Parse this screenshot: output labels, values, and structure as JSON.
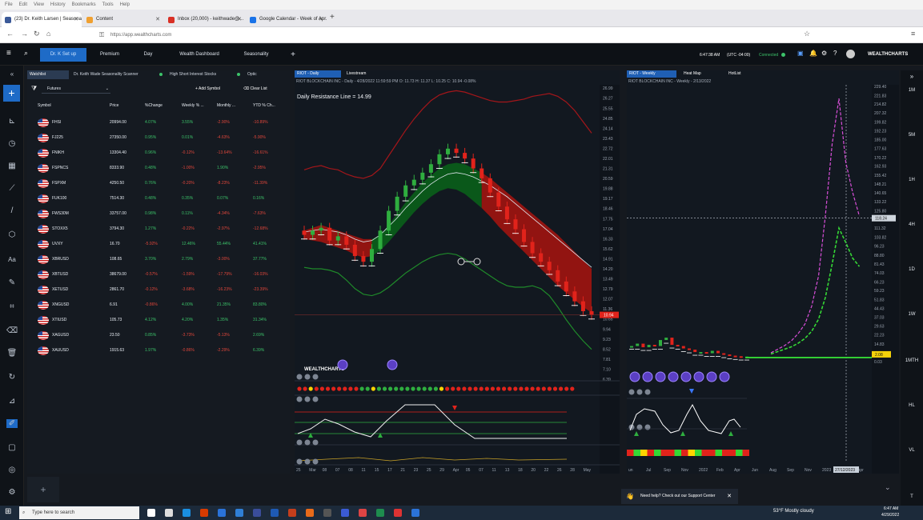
{
  "browser": {
    "menu": [
      "File",
      "Edit",
      "View",
      "History",
      "Bookmarks",
      "Tools",
      "Help"
    ],
    "tabs": [
      {
        "label": "(23) Dr. Keith Larsen | Seasonal",
        "favicon_color": "#3b5998",
        "active": true
      },
      {
        "label": "Content",
        "favicon_color": "#f0a030",
        "active": false
      },
      {
        "label": "Inbox (20,000) - keithwade@...",
        "favicon_color": "#d93025",
        "active": false
      },
      {
        "label": "Google Calendar - Week of Apr...",
        "favicon_color": "#1a73e8",
        "active": false
      }
    ],
    "url": "https://app.wealthcharts.com"
  },
  "nav": {
    "tabs": [
      "Dr. K Set up",
      "Premium",
      "Day",
      "Wealth Dashboard",
      "Seasonality"
    ],
    "add": "+",
    "time": "6:47:38 AM",
    "timezone": "(UTC -04:00)",
    "status": "Connected",
    "brand": "WEALTHCHARTS"
  },
  "watchlist": {
    "tabs": [
      "Watchlist",
      "Dr. Keith Wade Seasonality Scanner",
      "High Short Interest Stocks",
      "Optic"
    ],
    "filter": "Futures",
    "add_symbol": "Add Symbol",
    "clear_list": "Clear List",
    "columns": [
      "Symbol",
      "Price",
      "%Change",
      "Weekly % ...",
      "Monthly ...",
      "YTD % Ch..."
    ],
    "rows": [
      {
        "symbol": "FHSI",
        "price": "20994.00",
        "change": "4.07%",
        "weekly": "3.55%",
        "monthly": "-2.90%",
        "ytd": "-10.89%"
      },
      {
        "symbol": "FJ225",
        "price": "27350.00",
        "change": "0.95%",
        "weekly": "0.01%",
        "monthly": "-4.63%",
        "ytd": "-5.90%"
      },
      {
        "symbol": "FNIKH",
        "price": "13304.40",
        "change": "0.96%",
        "weekly": "-0.12%",
        "monthly": "-13.64%",
        "ytd": "-16.61%"
      },
      {
        "symbol": "FSPNCS",
        "price": "8333.90",
        "change": "0.48%",
        "weekly": "-1.00%",
        "monthly": "1.90%",
        "ytd": "-2.95%"
      },
      {
        "symbol": "FSPXM",
        "price": "4250.50",
        "change": "0.76%",
        "weekly": "-0.20%",
        "monthly": "-8.23%",
        "ytd": "-11.39%"
      },
      {
        "symbol": "FUK100",
        "price": "7514.30",
        "change": "0.48%",
        "weekly": "0.35%",
        "monthly": "0.07%",
        "ytd": "0.16%"
      },
      {
        "symbol": "FWS30M",
        "price": "33757.00",
        "change": "0.98%",
        "weekly": "0.11%",
        "monthly": "-4.34%",
        "ytd": "-7.63%"
      },
      {
        "symbol": "STOXX5",
        "price": "3794.30",
        "change": "1.27%",
        "weekly": "-0.22%",
        "monthly": "-2.97%",
        "ytd": "-12.68%"
      },
      {
        "symbol": "UVXY",
        "price": "16.70",
        "change": "-5.92%",
        "weekly": "12.46%",
        "monthly": "55.44%",
        "ytd": "41.41%"
      },
      {
        "symbol": "XBRUSD",
        "price": "108.65",
        "change": "3.70%",
        "weekly": "2.79%",
        "monthly": "-3.00%",
        "ytd": "37.77%"
      },
      {
        "symbol": "XBTUSD",
        "price": "38679.00",
        "change": "-0.57%",
        "weekly": "-1.59%",
        "monthly": "-17.79%",
        "ytd": "-16.03%"
      },
      {
        "symbol": "XETUSD",
        "price": "2861.70",
        "change": "-0.12%",
        "weekly": "-3.68%",
        "monthly": "-16.23%",
        "ytd": "-23.39%"
      },
      {
        "symbol": "XNGUSD",
        "price": "6.91",
        "change": "-0.86%",
        "weekly": "4.00%",
        "monthly": "21.35%",
        "ytd": "83.80%"
      },
      {
        "symbol": "XTIUSD",
        "price": "105.73",
        "change": "4.12%",
        "weekly": "4.20%",
        "monthly": "1.35%",
        "ytd": "31.34%"
      },
      {
        "symbol": "XAGUSD",
        "price": "23.50",
        "change": "0.85%",
        "weekly": "-3.73%",
        "monthly": "-5.13%",
        "ytd": "2.69%"
      },
      {
        "symbol": "XAUUSD",
        "price": "1915.63",
        "change": "1.97%",
        "weekly": "-0.86%",
        "monthly": "-2.29%",
        "ytd": "6.39%"
      }
    ]
  },
  "daily_chart": {
    "tabs": [
      "RIOT - Daily",
      "Livestream"
    ],
    "info": "RIOT BLOCKCHAIN INC - Daily - 4/28/2022 11:59:59 PM O: 11.73 H: 11.37 L: 10.25 C: 10.94 -0.08%",
    "resistance": "Daily Resistance Line = 14.99",
    "price_label": "10.94",
    "watermark": "WEALTHCHARTS",
    "price_axis": [
      "26.99",
      "26.27",
      "25.55",
      "24.85",
      "24.14",
      "23.43",
      "22.72",
      "22.01",
      "21.31",
      "20.59",
      "19.88",
      "19.17",
      "18.46",
      "17.75",
      "17.04",
      "16.33",
      "15.62",
      "14.91",
      "14.20",
      "13.49",
      "12.79",
      "12.07",
      "11.36",
      "10.65",
      "9.94",
      "9.23",
      "8.52",
      "7.81",
      "7.10",
      "6.39"
    ],
    "dates": [
      "25",
      "Mar",
      "08",
      "07",
      "08",
      "11",
      "15",
      "17",
      "21",
      "23",
      "25",
      "29",
      "Apr",
      "05",
      "07",
      "11",
      "13",
      "18",
      "20",
      "22",
      "26",
      "28",
      "May"
    ]
  },
  "weekly_chart": {
    "tabs": [
      "RIOT - Weekly",
      "Heat Map",
      "HotList"
    ],
    "info": "RIOT BLOCKCHAIN INC - Weekly - 2/13/2022",
    "price_label": "118.24",
    "low_label": "2.08",
    "price_axis": [
      "229.40",
      "221.83",
      "214.82",
      "207.32",
      "199.82",
      "192.23",
      "185.00",
      "177.63",
      "170.22",
      "162.93",
      "155.42",
      "148.21",
      "140.65",
      "133.22",
      "125.80",
      "118.24",
      "111.32",
      "103.82",
      "96.23",
      "88.80",
      "81.43",
      "74.03",
      "66.23",
      "59.23",
      "51.83",
      "44.43",
      "37.03",
      "29.63",
      "22.23",
      "14.83",
      "7.43",
      "0.03"
    ],
    "dates": [
      "un",
      "Jul",
      "Sep",
      "Nov",
      "2022",
      "Feb",
      "Apr",
      "Jun",
      "Aug",
      "Sep",
      "Nov",
      "2023",
      "Mar",
      "Apr"
    ],
    "date_highlight": "27/12/2023"
  },
  "timeframes": [
    "1M",
    "5M",
    "1H",
    "4H",
    "1D",
    "1W",
    "1MTH",
    "HL",
    "VL",
    "T"
  ],
  "help": "Need help? Check out our Support Center",
  "taskbar": {
    "search": "Type here to search",
    "weather": "53°F  Mostly cloudy",
    "time": "6:47 AM",
    "date": "4/29/2022"
  },
  "colors": {
    "accent": "#1e6bc7",
    "up": "#3cc36a",
    "down": "#e33a2a",
    "cloud_up": "#0a5f1a",
    "cloud_down": "#a1140f"
  },
  "chart_data": [
    {
      "type": "candlestick",
      "title": "RIOT - Daily",
      "ylim": [
        6.39,
        26.99
      ],
      "close": [
        16.6,
        16.9,
        17.1,
        16.2,
        16.5,
        15.9,
        15.1,
        14.7,
        15.6,
        16.9,
        18.3,
        19.3,
        20.1,
        20.5,
        21.0,
        21.6,
        22.3,
        22.7,
        22.4,
        22.0,
        21.3,
        20.6,
        19.6,
        18.6,
        17.7,
        17.0,
        16.1,
        15.3,
        14.7,
        14.1,
        13.3,
        12.6,
        11.9,
        11.2,
        10.94
      ],
      "mid": [
        16.8,
        16.9,
        17.0,
        16.9,
        16.8,
        16.6,
        16.3,
        16.1,
        16.2,
        16.6,
        17.2,
        17.8,
        18.5,
        19.1,
        19.7,
        20.2,
        20.6,
        20.9,
        21.0,
        20.9,
        20.7,
        20.4,
        20.1,
        19.7,
        19.3,
        18.8,
        18.3,
        17.8,
        17.3,
        16.8,
        16.3,
        15.8,
        15.3,
        14.8,
        14.3
      ],
      "upper": [
        21.2,
        21.4,
        21.5,
        21.3,
        21.2,
        20.9,
        20.7,
        20.6,
        20.8,
        21.3,
        22.2,
        23.1,
        24.0,
        24.8,
        25.5,
        26.1,
        26.5,
        26.7,
        26.8,
        26.7,
        26.5,
        26.3,
        26.1,
        26.0,
        26.0,
        26.1,
        26.2,
        26.4,
        26.5,
        26.6,
        26.4,
        26.0,
        25.4,
        24.6,
        23.8
      ],
      "lower": [
        14.3,
        14.2,
        14.2,
        14.1,
        13.9,
        13.4,
        12.8,
        12.4,
        12.3,
        12.5,
        12.9,
        13.4,
        13.9,
        14.3,
        14.7,
        15.0,
        15.2,
        15.3,
        15.2,
        14.9,
        14.5,
        14.1,
        13.7,
        13.3,
        13.0,
        12.9,
        12.9,
        13.0,
        12.8,
        12.3,
        11.5,
        10.6,
        9.8,
        9.1,
        8.5
      ],
      "ribbon_top": [
        16.9,
        17.1,
        17.3,
        17.1,
        16.9,
        16.7,
        16.5,
        16.3,
        16.3,
        16.6,
        17.3,
        18.1,
        18.9,
        19.6,
        20.3,
        20.8,
        21.3,
        21.6,
        21.7,
        21.6,
        21.3,
        21.0,
        20.6,
        20.1,
        19.6,
        19.1,
        18.6,
        18.1,
        17.6,
        17.1,
        16.6,
        16.0,
        15.4,
        14.8,
        14.2
      ],
      "ribbon_bottom": [
        16.3,
        16.2,
        16.1,
        15.9,
        15.7,
        15.5,
        15.2,
        15.0,
        15.1,
        15.5,
        16.1,
        16.8,
        17.5,
        18.2,
        18.8,
        19.3,
        19.7,
        19.9,
        19.8,
        19.5,
        19.0,
        18.5,
        17.9,
        17.2,
        16.6,
        16.0,
        15.4,
        14.8,
        14.2,
        13.6,
        13.0,
        12.5,
        12.0,
        11.5,
        11.1
      ]
    },
    {
      "type": "line",
      "title": "RIOT - Weekly",
      "ylim": [
        0.03,
        229.4
      ],
      "price": [
        11,
        13,
        10,
        12,
        11,
        16,
        18,
        12,
        11,
        9,
        8,
        6,
        6,
        5,
        7,
        5,
        4,
        3,
        2.5,
        2,
        2.2
      ],
      "projection_a": [
        6,
        9,
        12,
        16,
        22,
        30,
        45,
        70,
        120,
        180,
        218,
        165,
        140,
        120
      ],
      "projection_b": [
        5,
        7,
        9,
        11,
        14,
        18,
        24,
        34,
        52,
        80,
        110,
        98,
        85,
        78
      ]
    }
  ]
}
